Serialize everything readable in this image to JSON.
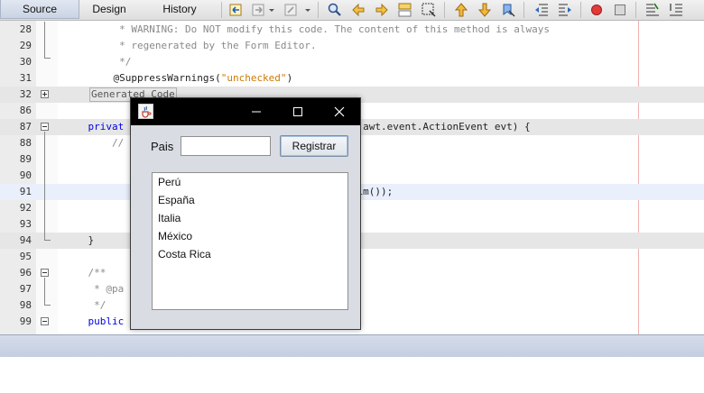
{
  "tabs": [
    {
      "label": "Source",
      "active": true
    },
    {
      "label": "Design",
      "active": false
    },
    {
      "label": "History",
      "active": false
    }
  ],
  "toolbar_icons": [
    "back-source-icon",
    "forward-source-icon",
    "last-edit-icon",
    "find-icon",
    "find-prev-icon",
    "find-next-icon",
    "toggle-highlight-icon",
    "toggle-rect-select-icon",
    "prev-bookmark-icon",
    "next-bookmark-icon",
    "toggle-bookmark-icon",
    "shift-left-icon",
    "shift-right-icon",
    "start-macro-icon",
    "stop-macro-icon",
    "comment-icon",
    "uncomment-icon"
  ],
  "lines": [
    {
      "num": "28",
      "text": "     * WARNING: Do NOT modify this code. The content of this method is always",
      "style": "comment"
    },
    {
      "num": "29",
      "text": "     * regenerated by the Form Editor.",
      "style": "comment"
    },
    {
      "num": "30",
      "text": "     */",
      "style": "comment"
    },
    {
      "num": "31",
      "pre": "    @SuppressWarnings(",
      "str": "\"unchecked\"",
      "post": ")",
      "style": "annotation"
    },
    {
      "num": "32",
      "gen": "Generated Code",
      "style": "generated"
    },
    {
      "num": "86",
      "text": "",
      "style": "plain"
    },
    {
      "num": "87",
      "kw": "    privat",
      "tail": "                               med(java.awt.event.ActionEvent evt) {",
      "style": "method"
    },
    {
      "num": "88",
      "text": "        //                                  e:",
      "style": "comment"
    },
    {
      "num": "89",
      "text": "",
      "style": "plain"
    },
    {
      "num": "90",
      "text": "",
      "style": "plain"
    },
    {
      "num": "91",
      "text": "                                         ext().trim());",
      "style": "plain"
    },
    {
      "num": "92",
      "text": "",
      "style": "plain"
    },
    {
      "num": "93",
      "text": "",
      "style": "plain"
    },
    {
      "num": "94",
      "text": "    }",
      "style": "plain"
    },
    {
      "num": "95",
      "text": "",
      "style": "plain"
    },
    {
      "num": "96",
      "text": "    /**",
      "style": "comment"
    },
    {
      "num": "97",
      "text": "     * @pa                                ents",
      "style": "comment"
    },
    {
      "num": "98",
      "text": "     */",
      "style": "comment"
    },
    {
      "num": "99",
      "kw": "    public",
      "tail": "                              ) {",
      "style": "method"
    }
  ],
  "dialog": {
    "title": "",
    "minimize_glyph": "—",
    "maximize_glyph": "☐",
    "close_glyph": "✕",
    "country_label": "Pais",
    "country_input_value": "",
    "register_button": "Registrar",
    "countries": [
      "Perú",
      "España",
      "Italia",
      "México",
      "Costa Rica"
    ]
  }
}
